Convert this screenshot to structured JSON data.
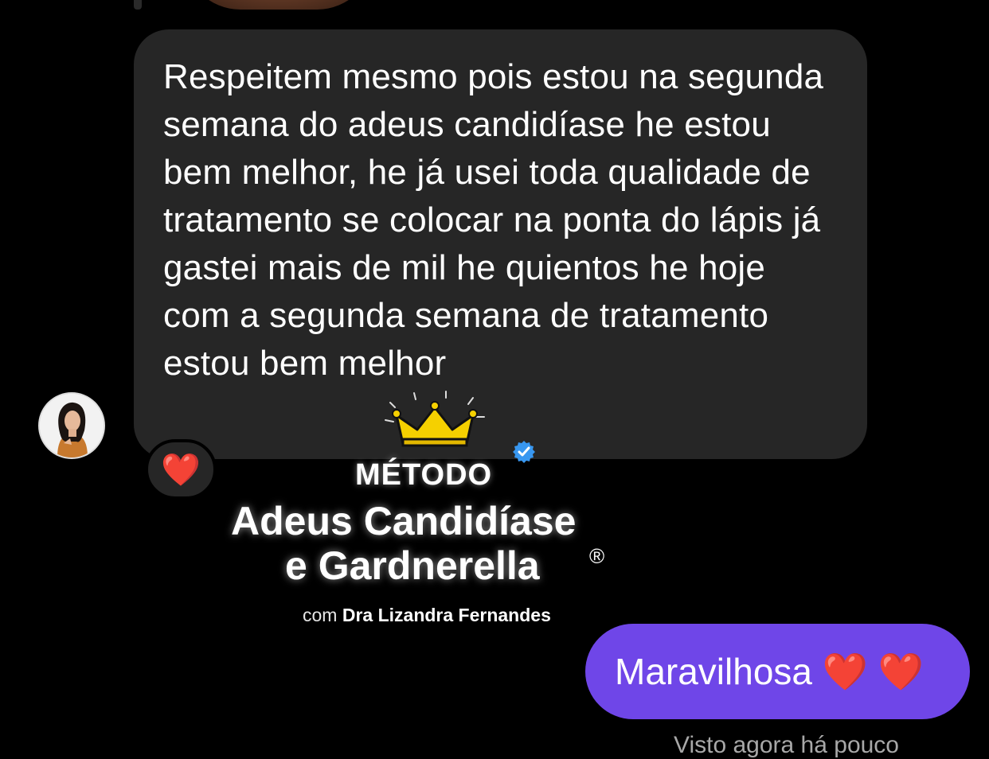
{
  "conversation": {
    "incoming_message": "Respeitem mesmo pois estou na segunda semana do adeus candidíase he estou bem melhor, he já usei toda qualidade de tratamento se colocar na ponta do lápis já gastei mais de mil he quientos he hoje com a segunda semana de tratamento estou bem melhor",
    "reaction": "❤️",
    "outgoing_message": "Maravilhosa ❤️ ❤️",
    "seen_status": "Visto agora há pouco"
  },
  "watermark": {
    "label": "MÉTODO",
    "title_line1": "Adeus Candidíase",
    "title_line2": "e Gardnerella",
    "registered": "®",
    "author_prefix": "com ",
    "author_name": "Dra Lizandra Fernandes"
  },
  "colors": {
    "background": "#000000",
    "incoming_bubble": "#262626",
    "outgoing_bubble": "#6f46e8",
    "crown": "#f5d000",
    "verified": "#3897f0"
  },
  "icons": {
    "crown": "crown-icon",
    "verified": "verified-badge-icon",
    "avatar": "user-avatar"
  }
}
